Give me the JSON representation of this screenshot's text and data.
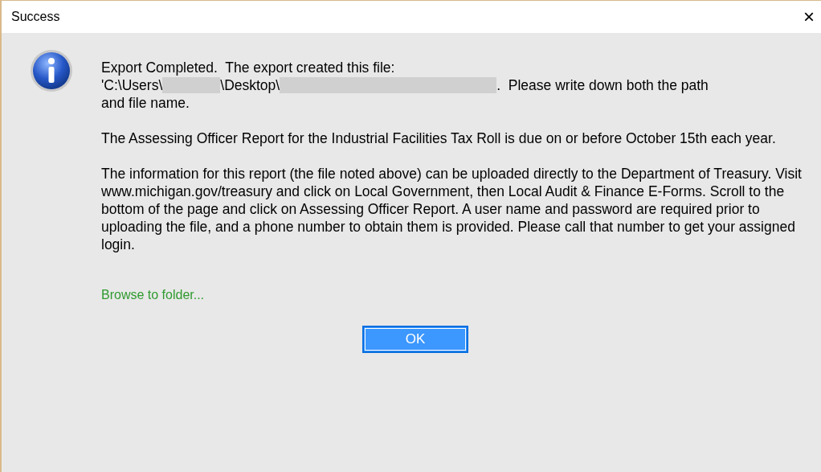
{
  "window": {
    "title": "Success",
    "close": "×"
  },
  "message": {
    "intro": "Export Completed.  The export created this file:",
    "path_segments": [
      {
        "kind": "text",
        "text": "'C:\\Users\\"
      },
      {
        "kind": "redacted"
      },
      {
        "kind": "text",
        "text": "\\Desktop\\"
      },
      {
        "kind": "redacted"
      },
      {
        "kind": "text",
        "text": ".  Please write down both the path"
      }
    ],
    "path_continuation": "and file name.",
    "paragraphs": [
      "The Assessing Officer Report for the Industrial Facilities Tax Roll is due on or before October 15th each year.",
      "The information for this report (the file noted above) can be uploaded directly to the Department of Treasury. Visit www.michigan.gov/treasury and click on Local Government, then Local Audit & Finance E-Forms. Scroll to the bottom of the page and click on Assessing Officer Report. A user name and password are required prior to uploading the file, and a phone number to obtain them is provided. Please call that number to get your assigned login."
    ]
  },
  "link": "Browse to folder...",
  "ok_button": "OK"
}
